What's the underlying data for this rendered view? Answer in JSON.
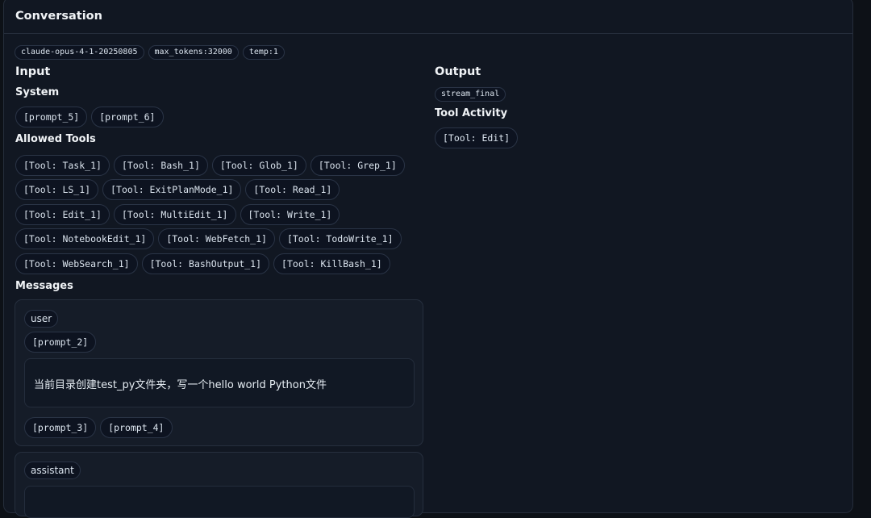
{
  "header": {
    "title": "Conversation"
  },
  "meta_tags": [
    "claude-opus-4-1-20250805",
    "max_tokens:32000",
    "temp:1"
  ],
  "input": {
    "title": "Input",
    "system": {
      "title": "System",
      "prompts": [
        "[prompt_5]",
        "[prompt_6]"
      ]
    },
    "allowed_tools": {
      "title": "Allowed Tools",
      "rows": [
        [
          "[Tool: Task_1]",
          "[Tool: Bash_1]",
          "[Tool: Glob_1]",
          "[Tool: Grep_1]"
        ],
        [
          "[Tool: LS_1]",
          "[Tool: ExitPlanMode_1]",
          "[Tool: Read_1]"
        ],
        [
          "[Tool: Edit_1]",
          "[Tool: MultiEdit_1]",
          "[Tool: Write_1]"
        ],
        [
          "[Tool: NotebookEdit_1]",
          "[Tool: WebFetch_1]",
          "[Tool: TodoWrite_1]"
        ],
        [
          "[Tool: WebSearch_1]",
          "[Tool: BashOutput_1]",
          "[Tool: KillBash_1]"
        ]
      ]
    },
    "messages": {
      "title": "Messages",
      "items": [
        {
          "role": "user",
          "before": [
            "[prompt_2]"
          ],
          "text": "当前目录创建test_py文件夹，写一个hello world Python文件",
          "after": [
            "[prompt_3]",
            "[prompt_4]"
          ]
        },
        {
          "role": "assistant"
        }
      ]
    }
  },
  "output": {
    "title": "Output",
    "stream_tag": "stream_final",
    "tool_activity": {
      "title": "Tool Activity",
      "items": [
        "[Tool: Edit]"
      ]
    }
  }
}
